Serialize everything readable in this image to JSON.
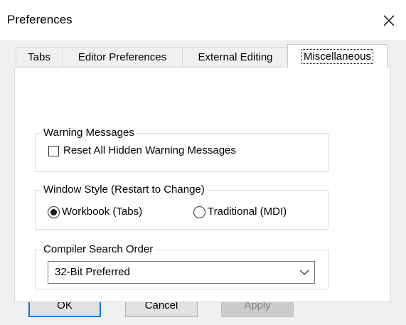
{
  "window": {
    "title": "Preferences",
    "close_icon": "close-icon"
  },
  "tabs": [
    {
      "label": "Tabs",
      "active": false
    },
    {
      "label": "Editor Preferences",
      "active": false
    },
    {
      "label": "External Editing",
      "active": false
    },
    {
      "label": "Miscellaneous",
      "active": true
    }
  ],
  "warning_group": {
    "title": "Warning Messages",
    "checkbox_label": "Reset All Hidden Warning Messages",
    "checked": false
  },
  "window_style_group": {
    "title": "Window Style (Restart to Change)",
    "options": [
      {
        "label": "Workbook (Tabs)",
        "selected": true
      },
      {
        "label": "Traditional (MDI)",
        "selected": false
      }
    ]
  },
  "compiler_group": {
    "title": "Compiler Search Order",
    "selected_value": "32-Bit Preferred"
  },
  "buttons": {
    "ok": "OK",
    "cancel": "Cancel",
    "apply": "Apply",
    "apply_disabled": true
  },
  "colors": {
    "focus_blue": "#0078d7",
    "client_bg": "#f0f0f0"
  }
}
